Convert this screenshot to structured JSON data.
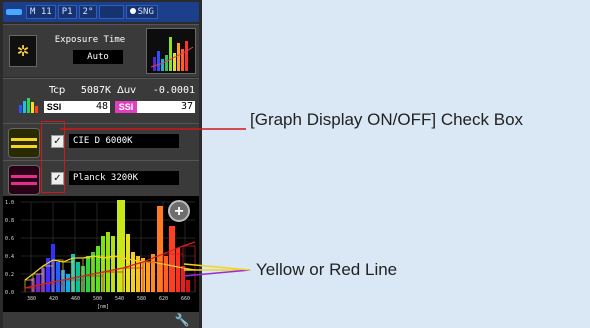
{
  "status": {
    "items": [
      "M 11",
      "P1",
      "2°",
      "SNG"
    ]
  },
  "exposure": {
    "title": "Exposure Time",
    "value": "Auto"
  },
  "measure": {
    "tcp_label": "Tcp",
    "tcp_value": "5087K",
    "duv_label": "Δuv",
    "duv_value": "-0.0001",
    "ssi1_label": "SSI",
    "ssi1_value": "48",
    "ssi2_label": "SSI",
    "ssi2_value": "37"
  },
  "references": [
    {
      "label": "CIE D 6000K",
      "checked": true,
      "color": "#f2d32a"
    },
    {
      "label": "Planck 3200K",
      "checked": true,
      "color": "#e0308a"
    }
  ],
  "graph": {
    "y_ticks": [
      "1.0",
      "0.8",
      "0.6",
      "0.4",
      "0.2",
      "0.0"
    ],
    "x_ticks": [
      "380",
      "420",
      "460",
      "500",
      "540",
      "580",
      "620",
      "660"
    ],
    "x_unit": "[nm]"
  },
  "callouts": {
    "checkbox": "[Graph Display ON/OFF] Check Box",
    "line": "Yellow or Red Line"
  },
  "colors": {
    "accent_red": "#d01818",
    "ref_yellow": "#f2d32a",
    "ref_red": "#d42020"
  },
  "icons": [
    "battery-icon",
    "sun-icon",
    "spectrum-icon",
    "checkbox-icon",
    "zoom-icon",
    "wrench-icon"
  ]
}
